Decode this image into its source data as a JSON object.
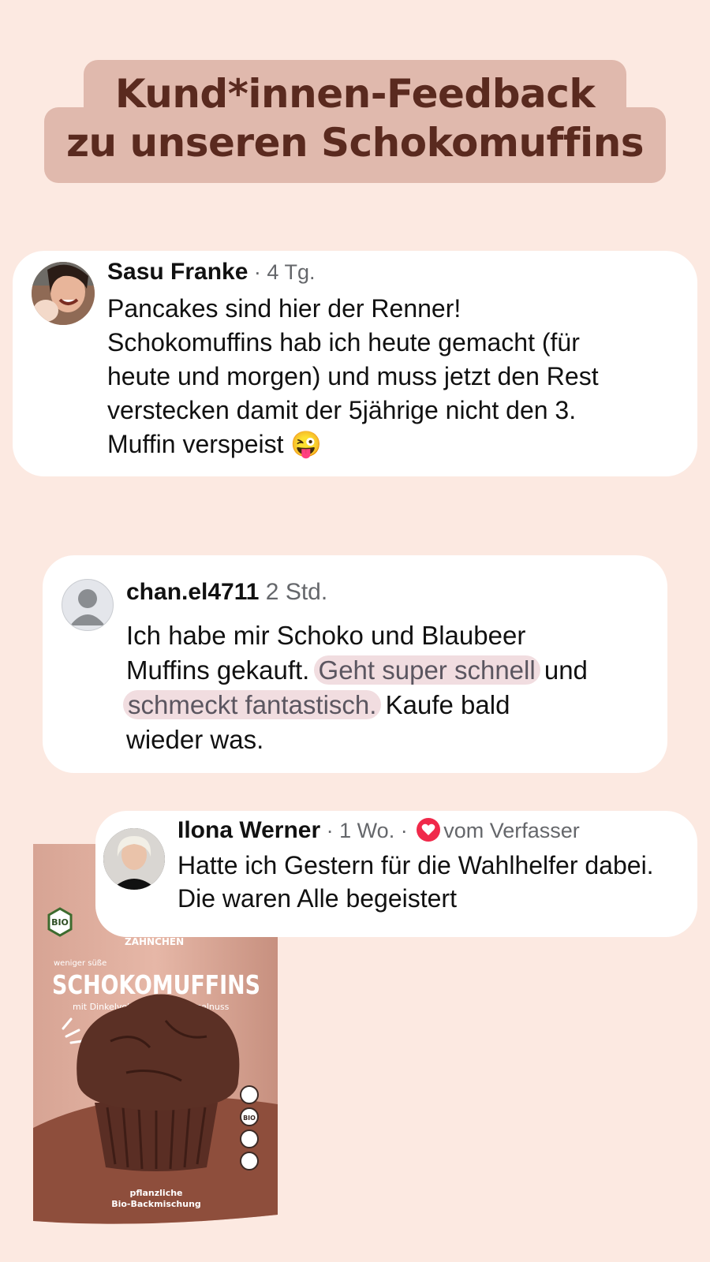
{
  "headline": {
    "line1": "Kund*innen-Feedback",
    "line2": "zu unseren Schokomuffins"
  },
  "comments": [
    {
      "author": "Sasu Franke",
      "meta": " · 4 Tg.",
      "lines": [
        "Pancakes sind hier der Renner!",
        "Schokomuffins hab ich heute gemacht (für",
        "heute und morgen) und muss jetzt den Rest",
        "verstecken damit der 5jährige nicht den 3."
      ],
      "last_line": "Muffin verspeist ",
      "emoji": "😜"
    },
    {
      "author": "chan.el4711",
      "meta": " 2 Std.",
      "line1": "Ich habe mir Schoko und Blaubeer",
      "line2_plain": "Muffins gekauft. ",
      "line2_highlight": "Geht super schnell",
      "line2_end": " und",
      "line3_highlight": "schmeckt fantastisch.",
      "line3_end": " Kaufe bald",
      "line4": "wieder was."
    },
    {
      "author": "Ilona Werner",
      "meta": " · 1 Wo. · ",
      "badge": "vom Verfasser",
      "line1": "Hatte ich Gestern für die Wahlhelfer dabei.",
      "line2": "Die waren Alle begeistert"
    }
  ],
  "package": {
    "brand": "ZAHNCHEN",
    "bio_badge": "BIO",
    "subtitle_top": "weniger süße",
    "product": "SCHOKOMUFFINS",
    "tagline": "mit Dinkelvollkornmehl & Haselnuss",
    "bottom_line1": "pflanzliche",
    "bottom_line2": "Bio-Backmischung",
    "seal_bio": "BIO"
  },
  "colors": {
    "background": "#fce9e1",
    "headline_bg": "#e0b9ad",
    "headline_text": "#5a2a1f",
    "highlight_bg": "#f1dde0",
    "heart": "#f0294a"
  }
}
